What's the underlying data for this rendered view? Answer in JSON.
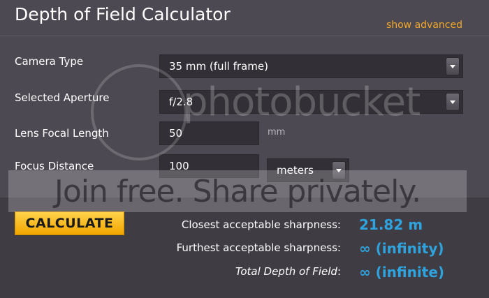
{
  "header": {
    "title": "Depth of Field Calculator",
    "advanced_link": "show advanced"
  },
  "form": {
    "camera_type": {
      "label": "Camera Type",
      "value": "35 mm (full frame)"
    },
    "aperture": {
      "label": "Selected Aperture",
      "value": "f/2.8"
    },
    "focal_length": {
      "label": "Lens Focal Length",
      "value": "50",
      "unit": "mm"
    },
    "focus_distance": {
      "label": "Focus Distance",
      "value": "100",
      "unit_value": "meters"
    }
  },
  "actions": {
    "calculate_label": "CALCULATE"
  },
  "results": {
    "closest": {
      "label": "Closest acceptable sharpness:",
      "value": "21.82 m"
    },
    "furthest": {
      "label": "Furthest acceptable sharpness:",
      "value": "∞ (infinity)"
    },
    "total": {
      "label": "Total Depth of Field",
      "colon": ":",
      "value": "∞ (infinite)"
    }
  },
  "watermark": {
    "logo_text": "photobucket",
    "banner_text": "Join free. Share privately."
  },
  "colors": {
    "background": "#4d4952",
    "accent_link": "#f2a92a",
    "result_value": "#2ea3dd",
    "button": "#f7b21a"
  }
}
